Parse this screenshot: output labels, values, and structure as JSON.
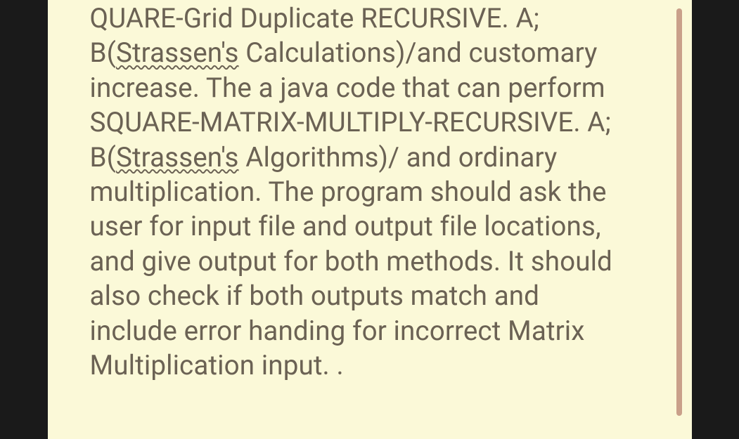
{
  "text": {
    "seg1": "QUARE-Grid Duplicate RECURSIVE. A; B(",
    "underlined1": "Strassen's",
    "seg2": " Calculations)/and customary increase. The a java code that can perform  SQUARE-MATRIX-MULTIPLY-RECURSIVE. A; B(",
    "underlined2": "Strassen's",
    "seg3": " Algorithms)/ and ordinary multiplication. The program should ask the user for input file and output file locations, and give output for both methods. It should also check if both outputs match and include error handing for incorrect Matrix Multiplication input. ."
  }
}
